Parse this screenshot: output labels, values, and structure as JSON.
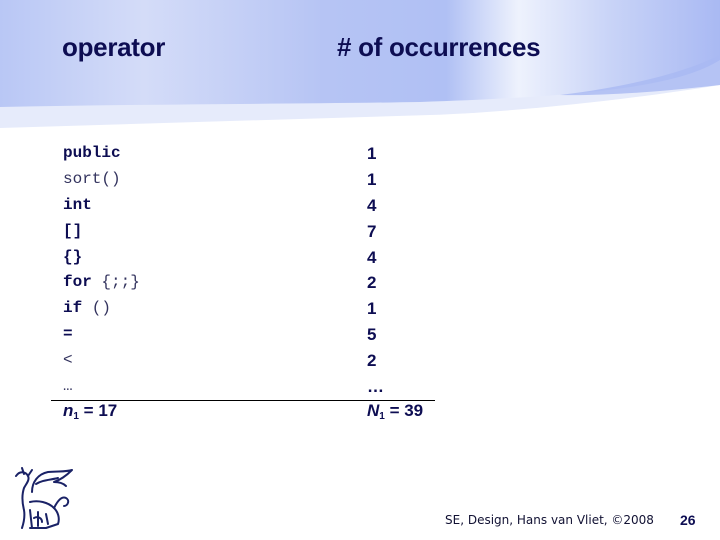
{
  "slide": {
    "headers": {
      "operator": "operator",
      "occurrences": "# of occurrences"
    },
    "rows": [
      {
        "operator_parts": [
          {
            "text": "public",
            "style": "kw"
          }
        ],
        "count": "1"
      },
      {
        "operator_parts": [
          {
            "text": "sort()",
            "style": "pl"
          }
        ],
        "count": "1"
      },
      {
        "operator_parts": [
          {
            "text": "int",
            "style": "kw"
          }
        ],
        "count": "4"
      },
      {
        "operator_parts": [
          {
            "text": "[]",
            "style": "sym"
          }
        ],
        "count": "7"
      },
      {
        "operator_parts": [
          {
            "text": "{}",
            "style": "sym"
          }
        ],
        "count": "4"
      },
      {
        "operator_parts": [
          {
            "text": "for",
            "style": "kw"
          },
          {
            "text": " {;;}",
            "style": "pl"
          }
        ],
        "count": "2"
      },
      {
        "operator_parts": [
          {
            "text": "if",
            "style": "kw"
          },
          {
            "text": " ()",
            "style": "pl"
          }
        ],
        "count": "1"
      },
      {
        "operator_parts": [
          {
            "text": "=",
            "style": "sym"
          }
        ],
        "count": "5"
      },
      {
        "operator_parts": [
          {
            "text": "<",
            "style": "pl"
          }
        ],
        "count": "2"
      },
      {
        "operator_parts": [
          {
            "text": "…",
            "style": "pl"
          }
        ],
        "count": "…"
      }
    ],
    "totals": {
      "left": {
        "var": "n",
        "sub": "1",
        "rest": " = 17"
      },
      "right": {
        "var": "N",
        "sub": "1",
        "rest": " = 39"
      }
    },
    "footer": {
      "text": "SE, Design, Hans van Vliet,  ©2008",
      "page_number": "26"
    },
    "logo_icon": "winged-lion-logo",
    "colors": {
      "title_text": "#0d0d52",
      "header_blue": "#a9b9f3",
      "header_light": "#e6ebfb"
    }
  }
}
